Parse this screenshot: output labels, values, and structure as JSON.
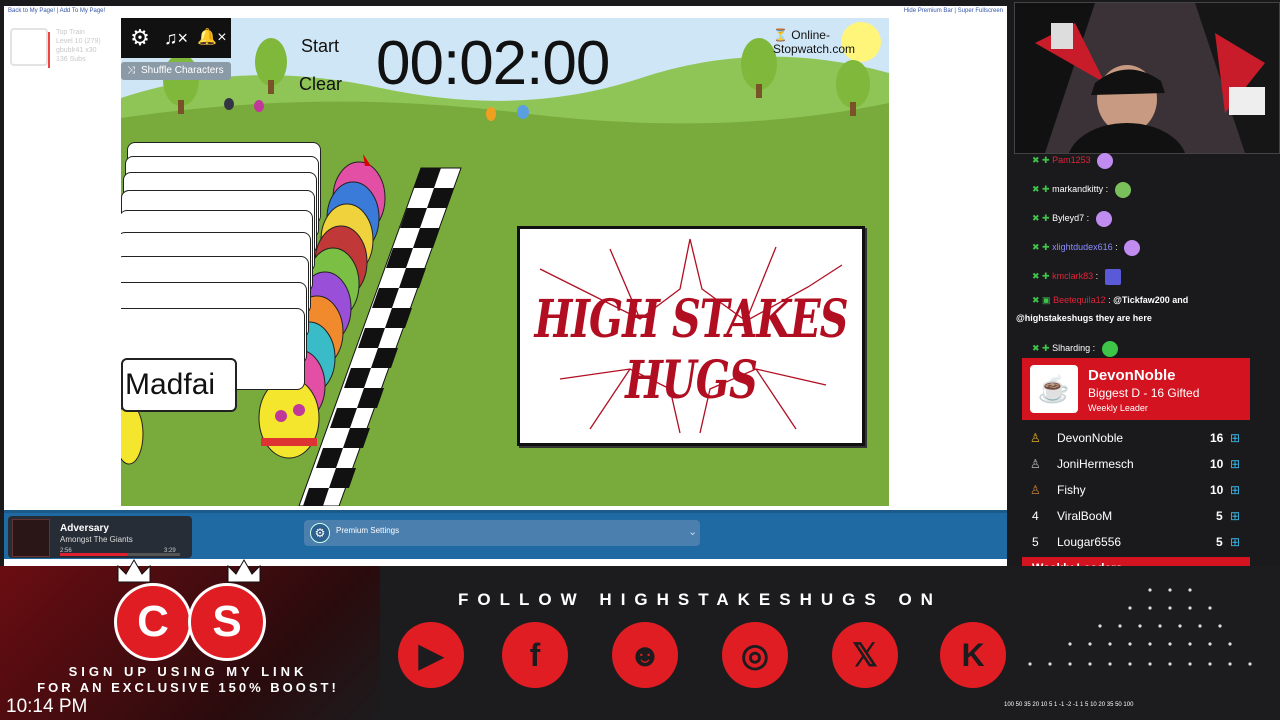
{
  "browser": {
    "top_links_left": "Back to My Page! | Add To My Page!",
    "top_links_right": "Hide Premium Bar | Super Fullscreen",
    "ghost_lines": [
      "Top Train",
      "Level 10  (279)",
      "gbublr41  x30",
      "136 Subs"
    ]
  },
  "game": {
    "controls": {
      "settings_icon": "gear-icon",
      "music_label": "♫×",
      "sound_label": "🔔×"
    },
    "shuffle_label": "Shuffle Characters",
    "start_label": "Start",
    "clear_label": "Clear",
    "timer": "00:02:00",
    "site_label": "Online-Stopwatch.com",
    "racer_name": "Madfai",
    "logo_text": "HIGH STAKES HUGS"
  },
  "premium_bar": {
    "settings_label": "Premium Settings"
  },
  "now_playing": {
    "title": "Adversary",
    "artist": "Amongst The Giants",
    "elapsed": "2:56",
    "duration": "3:29",
    "progress": 0.56
  },
  "chat": [
    {
      "user": "Pam1253",
      "msg": "",
      "color": "#e0243a",
      "emote": "#c08cf0"
    },
    {
      "user": "markandkitty",
      "msg": "",
      "color": "#ffffff",
      "emote": "#7ac05a"
    },
    {
      "user": "Byleyd7",
      "msg": "",
      "color": "#ffffff",
      "emote": "#c08cf0"
    },
    {
      "user": "xlightdudex616",
      "msg": "",
      "color": "#8c8cff",
      "emote": "#c08cf0"
    },
    {
      "user": "kmclark83",
      "msg": "",
      "color": "#e0243a",
      "emote": "#5a5ad8"
    },
    {
      "user": "Beetequila12",
      "msg": "@Tickfaw200 and",
      "color": "#e0243a",
      "emote": ""
    },
    {
      "user": "",
      "msg": "@highstakeshugs they are here",
      "color": "#ffffff",
      "emote": ""
    },
    {
      "user": "Slharding",
      "msg": "",
      "color": "#ffffff",
      "emote": "#3fc44a"
    }
  ],
  "leader_card": {
    "name": "DevonNoble",
    "subtitle": "Biggest D - 16 Gifted",
    "tag": "Weekly Leader"
  },
  "leaders": [
    {
      "rank": "1",
      "name": "DevonNoble",
      "count": "16"
    },
    {
      "rank": "2",
      "name": "JoniHermesch",
      "count": "10"
    },
    {
      "rank": "3",
      "name": "Fishy",
      "count": "10"
    },
    {
      "rank": "4",
      "name": "ViralBooM",
      "count": "5"
    },
    {
      "rank": "5",
      "name": "Lougar6556",
      "count": "5"
    }
  ],
  "weekly_label": "Weekly Leaders",
  "social": {
    "follow_text": "FOLLOW HIGHSTAKESHUGS ON",
    "icons": [
      "youtube-icon",
      "facebook-icon",
      "discord-icon",
      "instagram-icon",
      "x-icon",
      "kick-icon"
    ]
  },
  "promo": {
    "logo_left": "C",
    "logo_right": "S",
    "line1": "SIGN UP USING MY LINK",
    "line2": "FOR AN EXCLUSIVE 150% BOOST!"
  },
  "clock": "10:14 PM",
  "multipliers": "100 50 35 20 10 5 1 -1 -2 -1 1 5 10 20 35 50 100",
  "colors": {
    "brand_red": "#d31320",
    "premium_blue": "#1f6aa3",
    "grass": "#79aa3c"
  }
}
